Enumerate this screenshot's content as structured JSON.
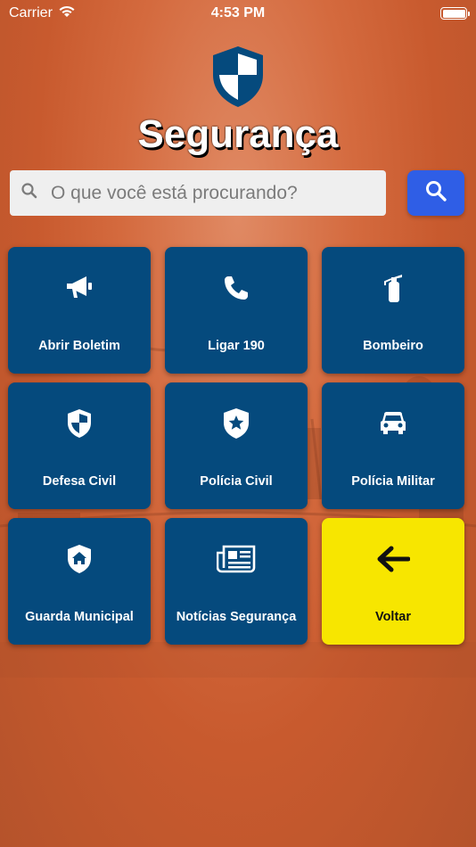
{
  "status_bar": {
    "carrier": "Carrier",
    "time": "4:53 PM"
  },
  "app": {
    "title": "Segurança",
    "logo_icon": "shield-icon"
  },
  "search": {
    "placeholder": "O que você está procurando?",
    "value": ""
  },
  "colors": {
    "tile": "#054a7d",
    "search_button": "#2f5ee6",
    "back_tile": "#f7e600",
    "background": "#d46a3e"
  },
  "tiles": [
    {
      "label": "Abrir Boletim",
      "icon": "megaphone-icon"
    },
    {
      "label": "Ligar 190",
      "icon": "phone-icon"
    },
    {
      "label": "Bombeiro",
      "icon": "fire-extinguisher-icon"
    },
    {
      "label": "Defesa Civil",
      "icon": "shield-icon"
    },
    {
      "label": "Polícia Civil",
      "icon": "police-badge-icon"
    },
    {
      "label": "Polícia Militar",
      "icon": "car-icon"
    },
    {
      "label": "Guarda Municipal",
      "icon": "home-shield-icon"
    },
    {
      "label": "Notícias Segurança",
      "icon": "newspaper-icon"
    },
    {
      "label": "Voltar",
      "icon": "arrow-left-icon"
    }
  ]
}
